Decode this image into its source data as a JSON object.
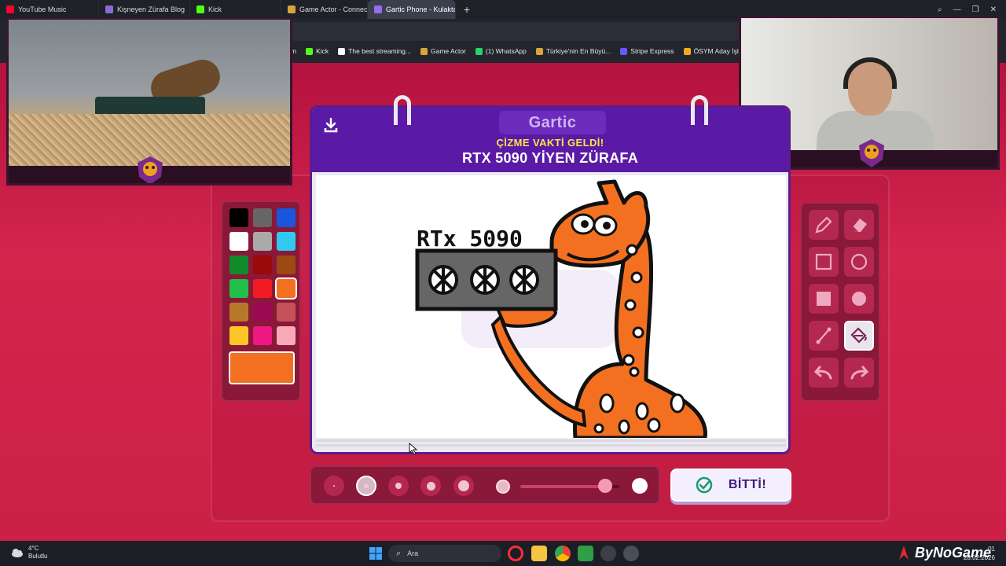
{
  "browser": {
    "tabs": [
      {
        "label": "YouTube Music",
        "icon": "youtube-music-icon",
        "color": "#ff0033"
      },
      {
        "label": "Kişneyen Zürafa Blog",
        "icon": "blog-icon",
        "color": "#8c6ad6"
      },
      {
        "label": "Kick",
        "icon": "kick-icon",
        "color": "#53fc18"
      },
      {
        "label": "Game Actor - Connect wit",
        "icon": "game-actor-icon",
        "color": "#d7a63a"
      },
      {
        "label": "Gartic Phone - Kulaktan K",
        "icon": "gartic-icon",
        "color": "#9b6bf2",
        "active": true
      }
    ],
    "bookmarks": [
      {
        "label": "m",
        "icon": "",
        "color": "#23252d"
      },
      {
        "label": "Kick",
        "icon": "kick-icon",
        "color": "#53fc18"
      },
      {
        "label": "The best streaming...",
        "icon": "diamond-icon",
        "color": "#ffffff"
      },
      {
        "label": "Game Actor",
        "icon": "game-actor-icon",
        "color": "#d7a63a"
      },
      {
        "label": "(1) WhatsApp",
        "icon": "whatsapp-icon",
        "color": "#25d366"
      },
      {
        "label": "Türkiye'nin En Büyü...",
        "icon": "site-icon",
        "color": "#d7a63a"
      },
      {
        "label": "Stripe Express",
        "icon": "stripe-icon",
        "color": "#635bff"
      },
      {
        "label": "ÖSYM Aday İşlemle...",
        "icon": "osym-icon",
        "color": "#f5a623"
      }
    ]
  },
  "game": {
    "logo": "Gartic",
    "subtitle": "ÇİZME VAKTİ GELDİ!",
    "prompt": "RTX 5090 YİYEN ZÜRAFA",
    "canvas_text": "RTx 5090",
    "palette": {
      "colors": [
        "#000000",
        "#666666",
        "#1a56db",
        "#ffffff",
        "#aaaaaa",
        "#33c8f0",
        "#108b2a",
        "#9a0a0a",
        "#9c4a12",
        "#22c04a",
        "#ef1c24",
        "#f37021",
        "#b8782a",
        "#9a0a52",
        "#c4505a",
        "#fcc628",
        "#ef1783",
        "#f9a8b8"
      ],
      "selected_index": 11,
      "current_color": "#f37021"
    },
    "tools": [
      {
        "name": "pencil-tool"
      },
      {
        "name": "eraser-tool"
      },
      {
        "name": "rectangle-outline-tool"
      },
      {
        "name": "ellipse-outline-tool"
      },
      {
        "name": "rectangle-fill-tool"
      },
      {
        "name": "ellipse-fill-tool"
      },
      {
        "name": "line-tool"
      },
      {
        "name": "bucket-fill-tool",
        "selected": true
      },
      {
        "name": "undo-tool"
      },
      {
        "name": "redo-tool"
      }
    ],
    "brush_sizes": {
      "count": 5,
      "selected_index": 1
    },
    "opacity": 0.86,
    "done_label": "BİTTİ!"
  },
  "taskbar": {
    "temperature": "4°C",
    "condition": "Bulutlu",
    "search_label": "Ara",
    "watermark": "ByNoGame",
    "time": "01",
    "date": "28.02.2026"
  },
  "colors": {
    "game_bg": "#cc2046",
    "header": "#5a1aa6",
    "accent_yellow": "#ffe34a"
  }
}
